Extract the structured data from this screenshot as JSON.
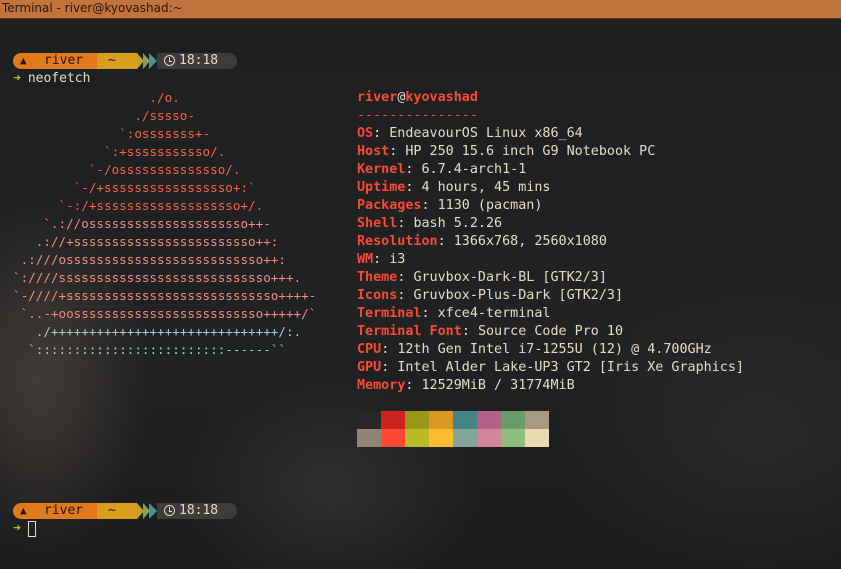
{
  "window": {
    "title": "Terminal - river@kyovashad:~"
  },
  "prompts": [
    {
      "user": "river",
      "dir": "~",
      "time": "18:18",
      "command": "neofetch"
    },
    {
      "user": "river",
      "dir": "~",
      "time": "18:18",
      "command": ""
    }
  ],
  "logo": [
    "                  ./o.",
    "                ./sssso-",
    "              `:osssssss+-",
    "            `:+sssssssssso/.",
    "          `-/ossssssssssssso/.",
    "        `-/+sssssssssssssssso+:`",
    "      `-:/+sssssssssssssssssso+/.",
    "    `.://osssssssssssssssssssso++-",
    "   .://+ssssssssssssssssssssssso++:",
    " .:///ossssssssssssssssssssssssso++:",
    "`:////ssssssssssssssssssssssssssso+++.",
    "`-////+ssssssssssssssssssssssssssso++++-",
    " `..-+oosssssssssssssssssssssssso+++++/`",
    "   ./++++++++++++++++++++++++++++++/:.",
    "  `:::::::::::::::::::::::::------``"
  ],
  "fetch": {
    "user": "river",
    "at": "@",
    "host": "kyovashad",
    "separator": "---------------",
    "fields": [
      {
        "key": "OS",
        "value": "EndeavourOS Linux x86_64"
      },
      {
        "key": "Host",
        "value": "HP 250 15.6 inch G9 Notebook PC"
      },
      {
        "key": "Kernel",
        "value": "6.7.4-arch1-1"
      },
      {
        "key": "Uptime",
        "value": "4 hours, 45 mins"
      },
      {
        "key": "Packages",
        "value": "1130 (pacman)"
      },
      {
        "key": "Shell",
        "value": "bash 5.2.26"
      },
      {
        "key": "Resolution",
        "value": "1366x768, 2560x1080"
      },
      {
        "key": "WM",
        "value": "i3"
      },
      {
        "key": "Theme",
        "value": "Gruvbox-Dark-BL [GTK2/3]"
      },
      {
        "key": "Icons",
        "value": "Gruvbox-Plus-Dark [GTK2/3]"
      },
      {
        "key": "Terminal",
        "value": "xfce4-terminal"
      },
      {
        "key": "Terminal Font",
        "value": "Source Code Pro 10"
      },
      {
        "key": "CPU",
        "value": "12th Gen Intel i7-1255U (12) @ 4.700GHz"
      },
      {
        "key": "GPU",
        "value": "Intel Alder Lake-UP3 GT2 [Iris Xe Graphics]"
      },
      {
        "key": "Memory",
        "value": "12529MiB / 31774MiB"
      }
    ]
  },
  "palette": {
    "normal": [
      "#282828",
      "#cc241d",
      "#98971a",
      "#d79921",
      "#458588",
      "#b16286",
      "#689d6a",
      "#a89984"
    ],
    "bright": [
      "#928374",
      "#fb4934",
      "#b8bb26",
      "#fabd2f",
      "#83a598",
      "#d3869b",
      "#8ec07c",
      "#ebdbb2"
    ]
  },
  "icons": {
    "user": "flame-icon",
    "time": "clock-icon",
    "arrow": "prompt-arrow-icon"
  }
}
